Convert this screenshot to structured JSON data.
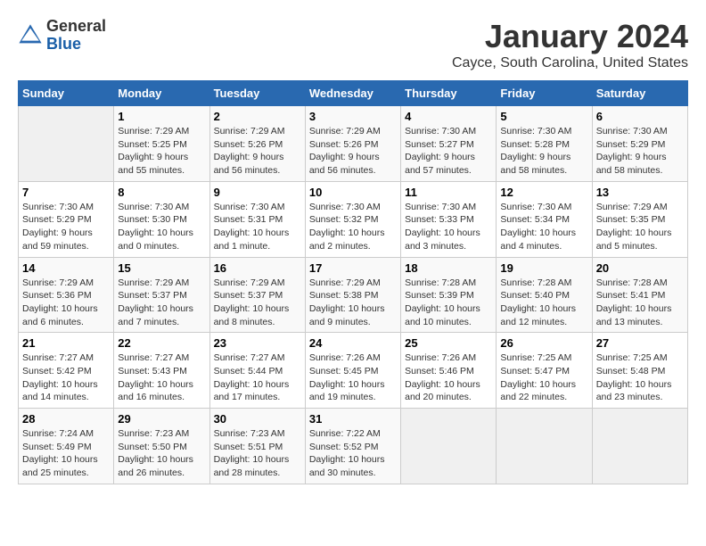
{
  "app": {
    "logo_general": "General",
    "logo_blue": "Blue"
  },
  "header": {
    "title": "January 2024",
    "subtitle": "Cayce, South Carolina, United States"
  },
  "calendar": {
    "weekdays": [
      "Sunday",
      "Monday",
      "Tuesday",
      "Wednesday",
      "Thursday",
      "Friday",
      "Saturday"
    ],
    "weeks": [
      [
        {
          "day": "",
          "sunrise": "",
          "sunset": "",
          "daylight": ""
        },
        {
          "day": "1",
          "sunrise": "Sunrise: 7:29 AM",
          "sunset": "Sunset: 5:25 PM",
          "daylight": "Daylight: 9 hours and 55 minutes."
        },
        {
          "day": "2",
          "sunrise": "Sunrise: 7:29 AM",
          "sunset": "Sunset: 5:26 PM",
          "daylight": "Daylight: 9 hours and 56 minutes."
        },
        {
          "day": "3",
          "sunrise": "Sunrise: 7:29 AM",
          "sunset": "Sunset: 5:26 PM",
          "daylight": "Daylight: 9 hours and 56 minutes."
        },
        {
          "day": "4",
          "sunrise": "Sunrise: 7:30 AM",
          "sunset": "Sunset: 5:27 PM",
          "daylight": "Daylight: 9 hours and 57 minutes."
        },
        {
          "day": "5",
          "sunrise": "Sunrise: 7:30 AM",
          "sunset": "Sunset: 5:28 PM",
          "daylight": "Daylight: 9 hours and 58 minutes."
        },
        {
          "day": "6",
          "sunrise": "Sunrise: 7:30 AM",
          "sunset": "Sunset: 5:29 PM",
          "daylight": "Daylight: 9 hours and 58 minutes."
        }
      ],
      [
        {
          "day": "7",
          "sunrise": "Sunrise: 7:30 AM",
          "sunset": "Sunset: 5:29 PM",
          "daylight": "Daylight: 9 hours and 59 minutes."
        },
        {
          "day": "8",
          "sunrise": "Sunrise: 7:30 AM",
          "sunset": "Sunset: 5:30 PM",
          "daylight": "Daylight: 10 hours and 0 minutes."
        },
        {
          "day": "9",
          "sunrise": "Sunrise: 7:30 AM",
          "sunset": "Sunset: 5:31 PM",
          "daylight": "Daylight: 10 hours and 1 minute."
        },
        {
          "day": "10",
          "sunrise": "Sunrise: 7:30 AM",
          "sunset": "Sunset: 5:32 PM",
          "daylight": "Daylight: 10 hours and 2 minutes."
        },
        {
          "day": "11",
          "sunrise": "Sunrise: 7:30 AM",
          "sunset": "Sunset: 5:33 PM",
          "daylight": "Daylight: 10 hours and 3 minutes."
        },
        {
          "day": "12",
          "sunrise": "Sunrise: 7:30 AM",
          "sunset": "Sunset: 5:34 PM",
          "daylight": "Daylight: 10 hours and 4 minutes."
        },
        {
          "day": "13",
          "sunrise": "Sunrise: 7:29 AM",
          "sunset": "Sunset: 5:35 PM",
          "daylight": "Daylight: 10 hours and 5 minutes."
        }
      ],
      [
        {
          "day": "14",
          "sunrise": "Sunrise: 7:29 AM",
          "sunset": "Sunset: 5:36 PM",
          "daylight": "Daylight: 10 hours and 6 minutes."
        },
        {
          "day": "15",
          "sunrise": "Sunrise: 7:29 AM",
          "sunset": "Sunset: 5:37 PM",
          "daylight": "Daylight: 10 hours and 7 minutes."
        },
        {
          "day": "16",
          "sunrise": "Sunrise: 7:29 AM",
          "sunset": "Sunset: 5:37 PM",
          "daylight": "Daylight: 10 hours and 8 minutes."
        },
        {
          "day": "17",
          "sunrise": "Sunrise: 7:29 AM",
          "sunset": "Sunset: 5:38 PM",
          "daylight": "Daylight: 10 hours and 9 minutes."
        },
        {
          "day": "18",
          "sunrise": "Sunrise: 7:28 AM",
          "sunset": "Sunset: 5:39 PM",
          "daylight": "Daylight: 10 hours and 10 minutes."
        },
        {
          "day": "19",
          "sunrise": "Sunrise: 7:28 AM",
          "sunset": "Sunset: 5:40 PM",
          "daylight": "Daylight: 10 hours and 12 minutes."
        },
        {
          "day": "20",
          "sunrise": "Sunrise: 7:28 AM",
          "sunset": "Sunset: 5:41 PM",
          "daylight": "Daylight: 10 hours and 13 minutes."
        }
      ],
      [
        {
          "day": "21",
          "sunrise": "Sunrise: 7:27 AM",
          "sunset": "Sunset: 5:42 PM",
          "daylight": "Daylight: 10 hours and 14 minutes."
        },
        {
          "day": "22",
          "sunrise": "Sunrise: 7:27 AM",
          "sunset": "Sunset: 5:43 PM",
          "daylight": "Daylight: 10 hours and 16 minutes."
        },
        {
          "day": "23",
          "sunrise": "Sunrise: 7:27 AM",
          "sunset": "Sunset: 5:44 PM",
          "daylight": "Daylight: 10 hours and 17 minutes."
        },
        {
          "day": "24",
          "sunrise": "Sunrise: 7:26 AM",
          "sunset": "Sunset: 5:45 PM",
          "daylight": "Daylight: 10 hours and 19 minutes."
        },
        {
          "day": "25",
          "sunrise": "Sunrise: 7:26 AM",
          "sunset": "Sunset: 5:46 PM",
          "daylight": "Daylight: 10 hours and 20 minutes."
        },
        {
          "day": "26",
          "sunrise": "Sunrise: 7:25 AM",
          "sunset": "Sunset: 5:47 PM",
          "daylight": "Daylight: 10 hours and 22 minutes."
        },
        {
          "day": "27",
          "sunrise": "Sunrise: 7:25 AM",
          "sunset": "Sunset: 5:48 PM",
          "daylight": "Daylight: 10 hours and 23 minutes."
        }
      ],
      [
        {
          "day": "28",
          "sunrise": "Sunrise: 7:24 AM",
          "sunset": "Sunset: 5:49 PM",
          "daylight": "Daylight: 10 hours and 25 minutes."
        },
        {
          "day": "29",
          "sunrise": "Sunrise: 7:23 AM",
          "sunset": "Sunset: 5:50 PM",
          "daylight": "Daylight: 10 hours and 26 minutes."
        },
        {
          "day": "30",
          "sunrise": "Sunrise: 7:23 AM",
          "sunset": "Sunset: 5:51 PM",
          "daylight": "Daylight: 10 hours and 28 minutes."
        },
        {
          "day": "31",
          "sunrise": "Sunrise: 7:22 AM",
          "sunset": "Sunset: 5:52 PM",
          "daylight": "Daylight: 10 hours and 30 minutes."
        },
        {
          "day": "",
          "sunrise": "",
          "sunset": "",
          "daylight": ""
        },
        {
          "day": "",
          "sunrise": "",
          "sunset": "",
          "daylight": ""
        },
        {
          "day": "",
          "sunrise": "",
          "sunset": "",
          "daylight": ""
        }
      ]
    ]
  }
}
